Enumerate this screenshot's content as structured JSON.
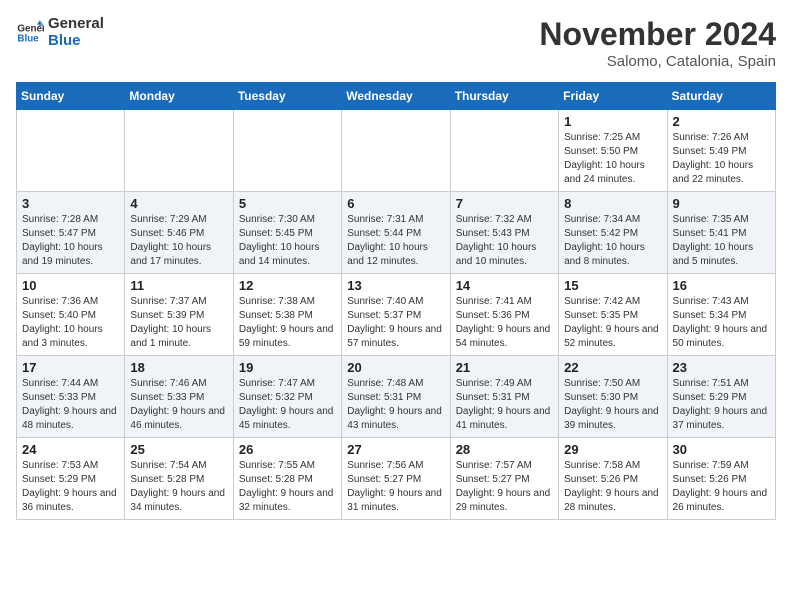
{
  "logo": {
    "line1": "General",
    "line2": "Blue"
  },
  "title": "November 2024",
  "location": "Salomo, Catalonia, Spain",
  "weekdays": [
    "Sunday",
    "Monday",
    "Tuesday",
    "Wednesday",
    "Thursday",
    "Friday",
    "Saturday"
  ],
  "weeks": [
    [
      {
        "day": "",
        "info": ""
      },
      {
        "day": "",
        "info": ""
      },
      {
        "day": "",
        "info": ""
      },
      {
        "day": "",
        "info": ""
      },
      {
        "day": "",
        "info": ""
      },
      {
        "day": "1",
        "info": "Sunrise: 7:25 AM\nSunset: 5:50 PM\nDaylight: 10 hours and 24 minutes."
      },
      {
        "day": "2",
        "info": "Sunrise: 7:26 AM\nSunset: 5:49 PM\nDaylight: 10 hours and 22 minutes."
      }
    ],
    [
      {
        "day": "3",
        "info": "Sunrise: 7:28 AM\nSunset: 5:47 PM\nDaylight: 10 hours and 19 minutes."
      },
      {
        "day": "4",
        "info": "Sunrise: 7:29 AM\nSunset: 5:46 PM\nDaylight: 10 hours and 17 minutes."
      },
      {
        "day": "5",
        "info": "Sunrise: 7:30 AM\nSunset: 5:45 PM\nDaylight: 10 hours and 14 minutes."
      },
      {
        "day": "6",
        "info": "Sunrise: 7:31 AM\nSunset: 5:44 PM\nDaylight: 10 hours and 12 minutes."
      },
      {
        "day": "7",
        "info": "Sunrise: 7:32 AM\nSunset: 5:43 PM\nDaylight: 10 hours and 10 minutes."
      },
      {
        "day": "8",
        "info": "Sunrise: 7:34 AM\nSunset: 5:42 PM\nDaylight: 10 hours and 8 minutes."
      },
      {
        "day": "9",
        "info": "Sunrise: 7:35 AM\nSunset: 5:41 PM\nDaylight: 10 hours and 5 minutes."
      }
    ],
    [
      {
        "day": "10",
        "info": "Sunrise: 7:36 AM\nSunset: 5:40 PM\nDaylight: 10 hours and 3 minutes."
      },
      {
        "day": "11",
        "info": "Sunrise: 7:37 AM\nSunset: 5:39 PM\nDaylight: 10 hours and 1 minute."
      },
      {
        "day": "12",
        "info": "Sunrise: 7:38 AM\nSunset: 5:38 PM\nDaylight: 9 hours and 59 minutes."
      },
      {
        "day": "13",
        "info": "Sunrise: 7:40 AM\nSunset: 5:37 PM\nDaylight: 9 hours and 57 minutes."
      },
      {
        "day": "14",
        "info": "Sunrise: 7:41 AM\nSunset: 5:36 PM\nDaylight: 9 hours and 54 minutes."
      },
      {
        "day": "15",
        "info": "Sunrise: 7:42 AM\nSunset: 5:35 PM\nDaylight: 9 hours and 52 minutes."
      },
      {
        "day": "16",
        "info": "Sunrise: 7:43 AM\nSunset: 5:34 PM\nDaylight: 9 hours and 50 minutes."
      }
    ],
    [
      {
        "day": "17",
        "info": "Sunrise: 7:44 AM\nSunset: 5:33 PM\nDaylight: 9 hours and 48 minutes."
      },
      {
        "day": "18",
        "info": "Sunrise: 7:46 AM\nSunset: 5:33 PM\nDaylight: 9 hours and 46 minutes."
      },
      {
        "day": "19",
        "info": "Sunrise: 7:47 AM\nSunset: 5:32 PM\nDaylight: 9 hours and 45 minutes."
      },
      {
        "day": "20",
        "info": "Sunrise: 7:48 AM\nSunset: 5:31 PM\nDaylight: 9 hours and 43 minutes."
      },
      {
        "day": "21",
        "info": "Sunrise: 7:49 AM\nSunset: 5:31 PM\nDaylight: 9 hours and 41 minutes."
      },
      {
        "day": "22",
        "info": "Sunrise: 7:50 AM\nSunset: 5:30 PM\nDaylight: 9 hours and 39 minutes."
      },
      {
        "day": "23",
        "info": "Sunrise: 7:51 AM\nSunset: 5:29 PM\nDaylight: 9 hours and 37 minutes."
      }
    ],
    [
      {
        "day": "24",
        "info": "Sunrise: 7:53 AM\nSunset: 5:29 PM\nDaylight: 9 hours and 36 minutes."
      },
      {
        "day": "25",
        "info": "Sunrise: 7:54 AM\nSunset: 5:28 PM\nDaylight: 9 hours and 34 minutes."
      },
      {
        "day": "26",
        "info": "Sunrise: 7:55 AM\nSunset: 5:28 PM\nDaylight: 9 hours and 32 minutes."
      },
      {
        "day": "27",
        "info": "Sunrise: 7:56 AM\nSunset: 5:27 PM\nDaylight: 9 hours and 31 minutes."
      },
      {
        "day": "28",
        "info": "Sunrise: 7:57 AM\nSunset: 5:27 PM\nDaylight: 9 hours and 29 minutes."
      },
      {
        "day": "29",
        "info": "Sunrise: 7:58 AM\nSunset: 5:26 PM\nDaylight: 9 hours and 28 minutes."
      },
      {
        "day": "30",
        "info": "Sunrise: 7:59 AM\nSunset: 5:26 PM\nDaylight: 9 hours and 26 minutes."
      }
    ]
  ]
}
